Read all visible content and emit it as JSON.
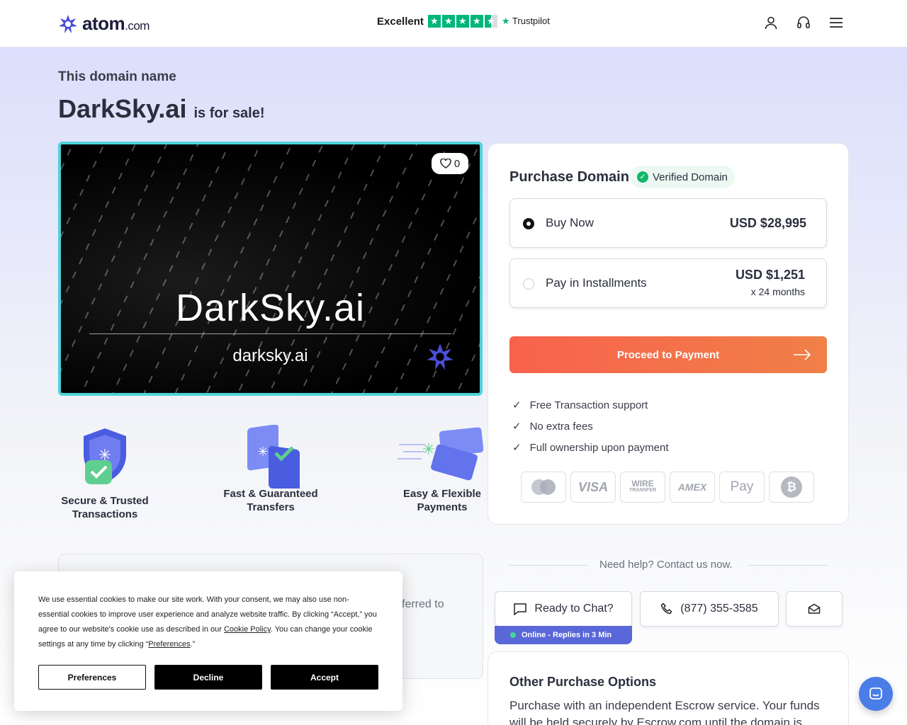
{
  "header": {
    "logo_main": "atom",
    "logo_tld": ".com",
    "rating_label": "Excellent",
    "trustpilot": "Trustpilot",
    "icons": [
      "user-icon",
      "headset-icon",
      "menu-icon"
    ]
  },
  "title": {
    "intro": "This domain name",
    "domain": "DarkSky.ai",
    "suffix": "is for sale!"
  },
  "hero": {
    "name": "DarkSky.ai",
    "url": "darksky.ai",
    "favorites": "0"
  },
  "features": [
    {
      "line1": "Secure & Trusted",
      "line2": "Transactions"
    },
    {
      "line1": "Fast & Guaranteed",
      "line2": "Transfers"
    },
    {
      "line1": "Easy & Flexible",
      "line2": "Payments"
    }
  ],
  "purchase": {
    "title": "Purchase Domain",
    "verified": "Verified Domain",
    "options": [
      {
        "label": "Buy Now",
        "price": "USD $28,995",
        "selected": true
      },
      {
        "label": "Pay in Installments",
        "price": "USD $1,251",
        "sub": "x 24 months",
        "selected": false
      }
    ],
    "proceed": "Proceed to Payment",
    "benefits": [
      "Free Transaction support",
      "No extra fees",
      "Full ownership upon payment"
    ],
    "payment_methods": [
      "mastercard-icon",
      "visa-icon",
      "wire-transfer-icon",
      "amex-icon",
      "apple-pay-icon",
      "bitcoin-icon"
    ],
    "visa": "VISA",
    "wire": "WIRE",
    "wire_sub": "TRANSFER",
    "amex": "AMEX",
    "applepay": "Pay",
    "bitcoin": "₿"
  },
  "description": {
    "partial": "ferred to"
  },
  "help": {
    "text": "Need help? Contact us now.",
    "chat": "Ready to Chat?",
    "phone": "(877) 355-3585",
    "online": "Online - Replies in 3 Min"
  },
  "other": {
    "title": "Other Purchase Options",
    "text": "Purchase with an independent Escrow service. Your funds will be held securely by Escrow.com until the domain is"
  },
  "cookie": {
    "text_a": "We use essential cookies to make our site work. With your consent, we may also use non-essential cookies to improve user experience and analyze website traffic. By clicking “Accept,” you agree to our website's cookie use as described in our ",
    "policy_link": "Cookie Policy",
    "text_b": ". You can change your cookie settings at any time by clicking “",
    "prefs_link": "Preferences",
    "text_c": ".”",
    "btn_preferences": "Preferences",
    "btn_decline": "Decline",
    "btn_accept": "Accept"
  },
  "colors": {
    "accent": "#f8624d",
    "brand": "#4a4fd8",
    "trustpilot": "#00b67a",
    "verified": "#12b76a",
    "hero_border": "#4fd1d9"
  }
}
